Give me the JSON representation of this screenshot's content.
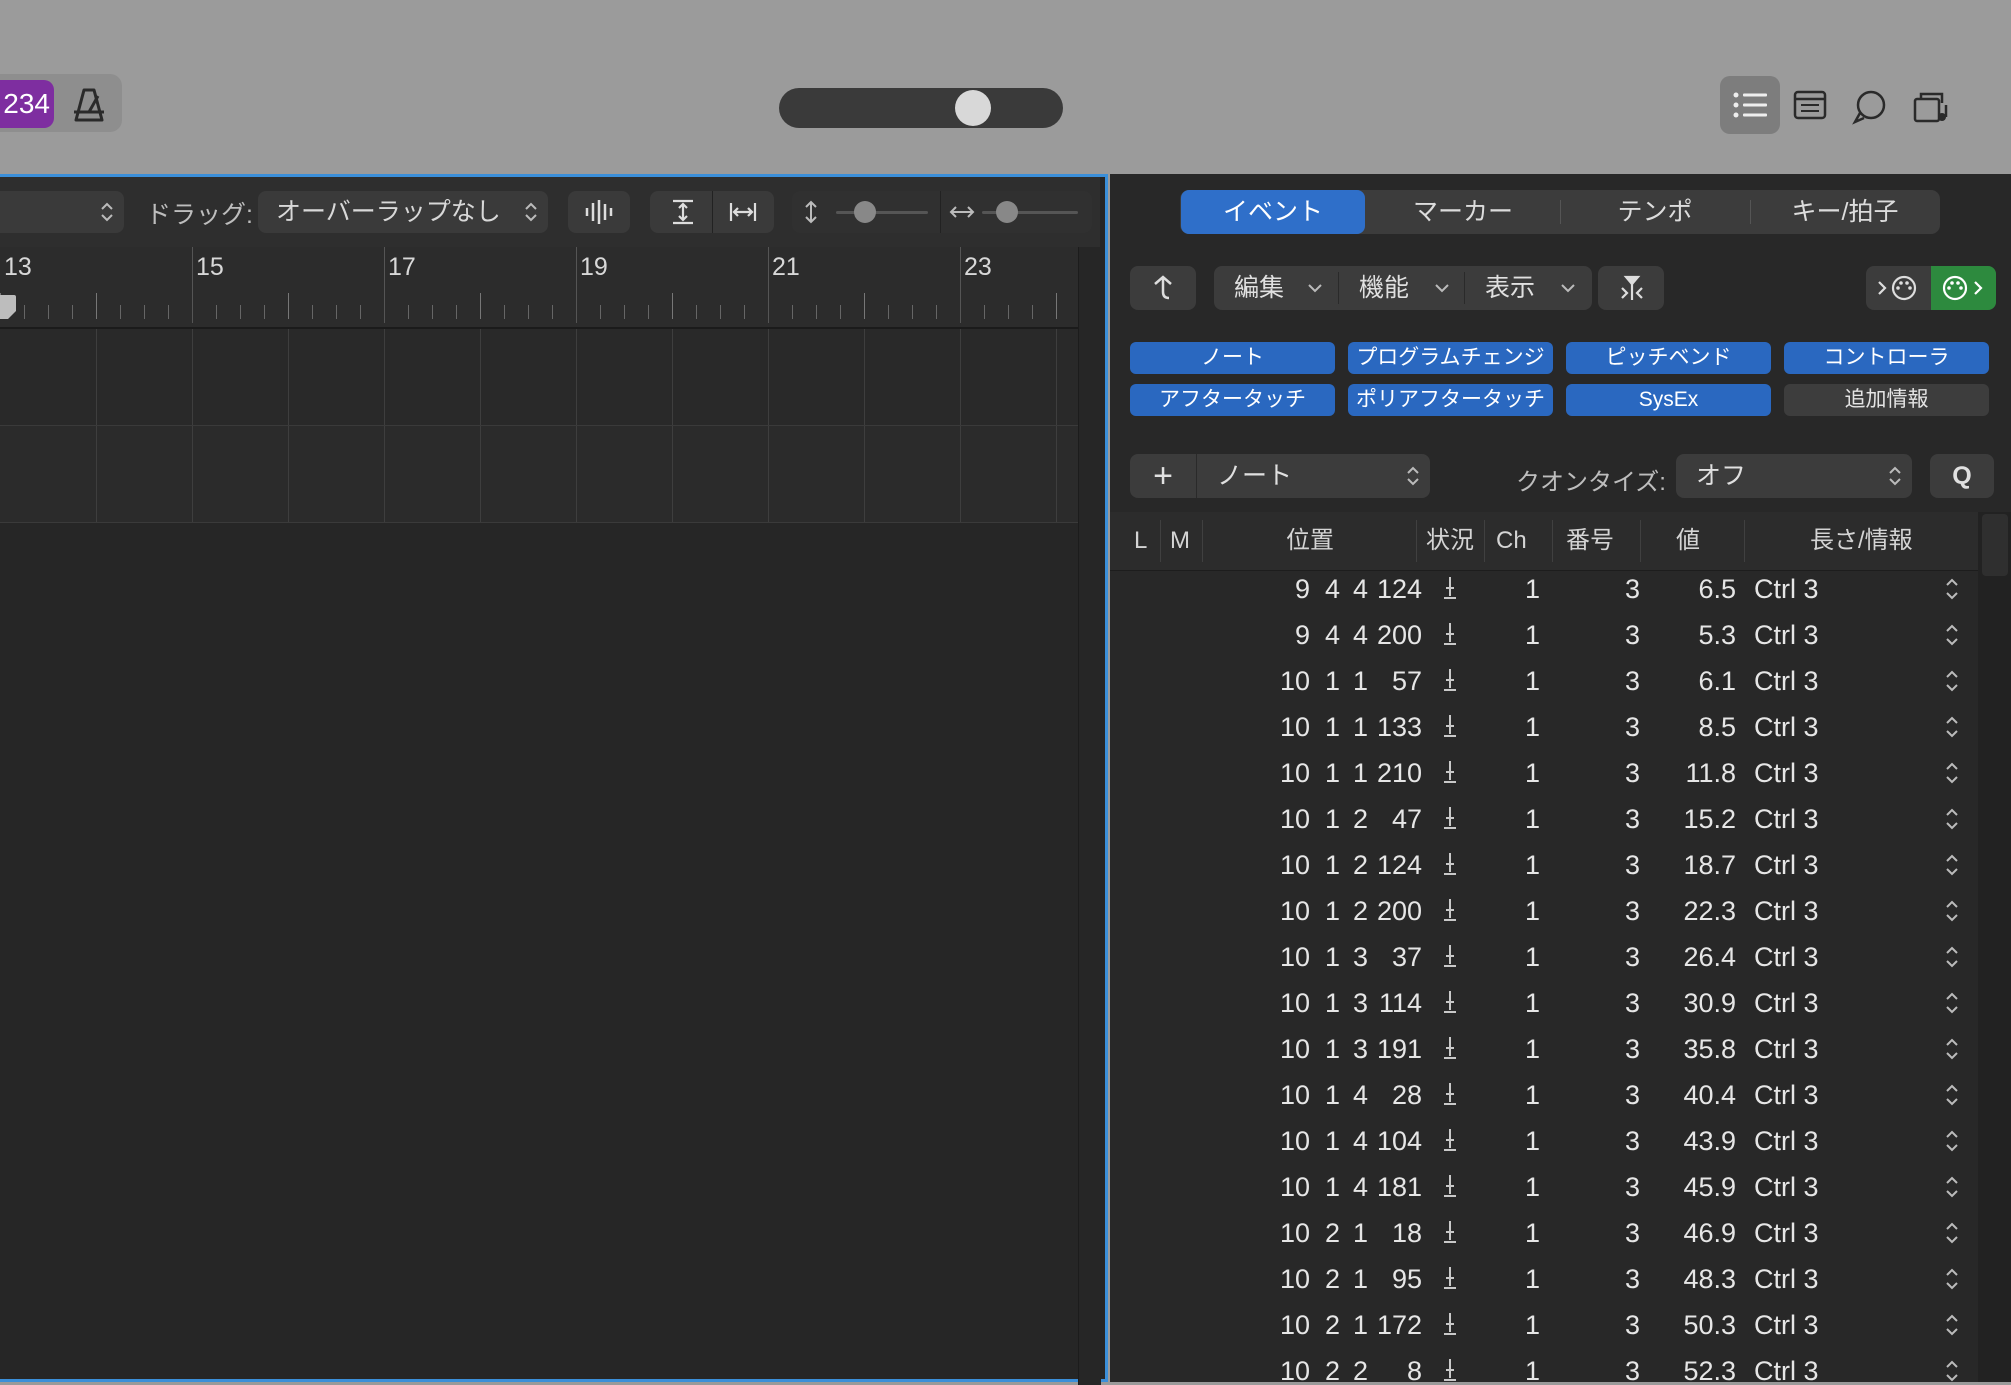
{
  "transport": {
    "lcd_text": "234"
  },
  "editor": {
    "drag_label": "ドラッグ:",
    "drag_value": "オーバーラップなし",
    "ruler_numbers": [
      "13",
      "15",
      "17",
      "19",
      "21",
      "23"
    ]
  },
  "list_editor": {
    "tabs": [
      "イベント",
      "マーカー",
      "テンポ",
      "キー/拍子"
    ],
    "menus": {
      "edit": "編集",
      "functions": "機能",
      "view": "表示"
    },
    "filters": [
      {
        "label": "ノート",
        "on": true
      },
      {
        "label": "プログラムチェンジ",
        "on": true
      },
      {
        "label": "ピッチベンド",
        "on": true
      },
      {
        "label": "コントローラ",
        "on": true
      },
      {
        "label": "アフタータッチ",
        "on": true
      },
      {
        "label": "ポリアフタータッチ",
        "on": true
      },
      {
        "label": "SysEx",
        "on": true
      },
      {
        "label": "追加情報",
        "on": false
      }
    ],
    "add_symbol": "+",
    "event_type": "ノート",
    "quantize_label": "クオンタイズ:",
    "quantize_value": "オフ",
    "q_button": "Q",
    "columns": {
      "l": "L",
      "m": "M",
      "position": "位置",
      "status": "状況",
      "ch": "Ch",
      "num": "番号",
      "value": "値",
      "length": "長さ/情報"
    },
    "rows": [
      {
        "bar": "9",
        "beat": "4",
        "div": "4",
        "tick": "124",
        "ch": "1",
        "num": "3",
        "value": "6.5",
        "info": "Ctrl 3"
      },
      {
        "bar": "9",
        "beat": "4",
        "div": "4",
        "tick": "200",
        "ch": "1",
        "num": "3",
        "value": "5.3",
        "info": "Ctrl 3"
      },
      {
        "bar": "10",
        "beat": "1",
        "div": "1",
        "tick": "57",
        "ch": "1",
        "num": "3",
        "value": "6.1",
        "info": "Ctrl 3"
      },
      {
        "bar": "10",
        "beat": "1",
        "div": "1",
        "tick": "133",
        "ch": "1",
        "num": "3",
        "value": "8.5",
        "info": "Ctrl 3"
      },
      {
        "bar": "10",
        "beat": "1",
        "div": "1",
        "tick": "210",
        "ch": "1",
        "num": "3",
        "value": "11.8",
        "info": "Ctrl 3"
      },
      {
        "bar": "10",
        "beat": "1",
        "div": "2",
        "tick": "47",
        "ch": "1",
        "num": "3",
        "value": "15.2",
        "info": "Ctrl 3"
      },
      {
        "bar": "10",
        "beat": "1",
        "div": "2",
        "tick": "124",
        "ch": "1",
        "num": "3",
        "value": "18.7",
        "info": "Ctrl 3"
      },
      {
        "bar": "10",
        "beat": "1",
        "div": "2",
        "tick": "200",
        "ch": "1",
        "num": "3",
        "value": "22.3",
        "info": "Ctrl 3"
      },
      {
        "bar": "10",
        "beat": "1",
        "div": "3",
        "tick": "37",
        "ch": "1",
        "num": "3",
        "value": "26.4",
        "info": "Ctrl 3"
      },
      {
        "bar": "10",
        "beat": "1",
        "div": "3",
        "tick": "114",
        "ch": "1",
        "num": "3",
        "value": "30.9",
        "info": "Ctrl 3"
      },
      {
        "bar": "10",
        "beat": "1",
        "div": "3",
        "tick": "191",
        "ch": "1",
        "num": "3",
        "value": "35.8",
        "info": "Ctrl 3"
      },
      {
        "bar": "10",
        "beat": "1",
        "div": "4",
        "tick": "28",
        "ch": "1",
        "num": "3",
        "value": "40.4",
        "info": "Ctrl 3"
      },
      {
        "bar": "10",
        "beat": "1",
        "div": "4",
        "tick": "104",
        "ch": "1",
        "num": "3",
        "value": "43.9",
        "info": "Ctrl 3"
      },
      {
        "bar": "10",
        "beat": "1",
        "div": "4",
        "tick": "181",
        "ch": "1",
        "num": "3",
        "value": "45.9",
        "info": "Ctrl 3"
      },
      {
        "bar": "10",
        "beat": "2",
        "div": "1",
        "tick": "18",
        "ch": "1",
        "num": "3",
        "value": "46.9",
        "info": "Ctrl 3"
      },
      {
        "bar": "10",
        "beat": "2",
        "div": "1",
        "tick": "95",
        "ch": "1",
        "num": "3",
        "value": "48.3",
        "info": "Ctrl 3"
      },
      {
        "bar": "10",
        "beat": "2",
        "div": "1",
        "tick": "172",
        "ch": "1",
        "num": "3",
        "value": "50.3",
        "info": "Ctrl 3"
      },
      {
        "bar": "10",
        "beat": "2",
        "div": "2",
        "tick": "8",
        "ch": "1",
        "num": "3",
        "value": "52.3",
        "info": "Ctrl 3"
      }
    ]
  },
  "colors": {
    "accent": "#2f6fc9",
    "selection_border": "#3b8fd9",
    "lcd": "#7e2ea0",
    "active_green": "#2d8a3e"
  }
}
